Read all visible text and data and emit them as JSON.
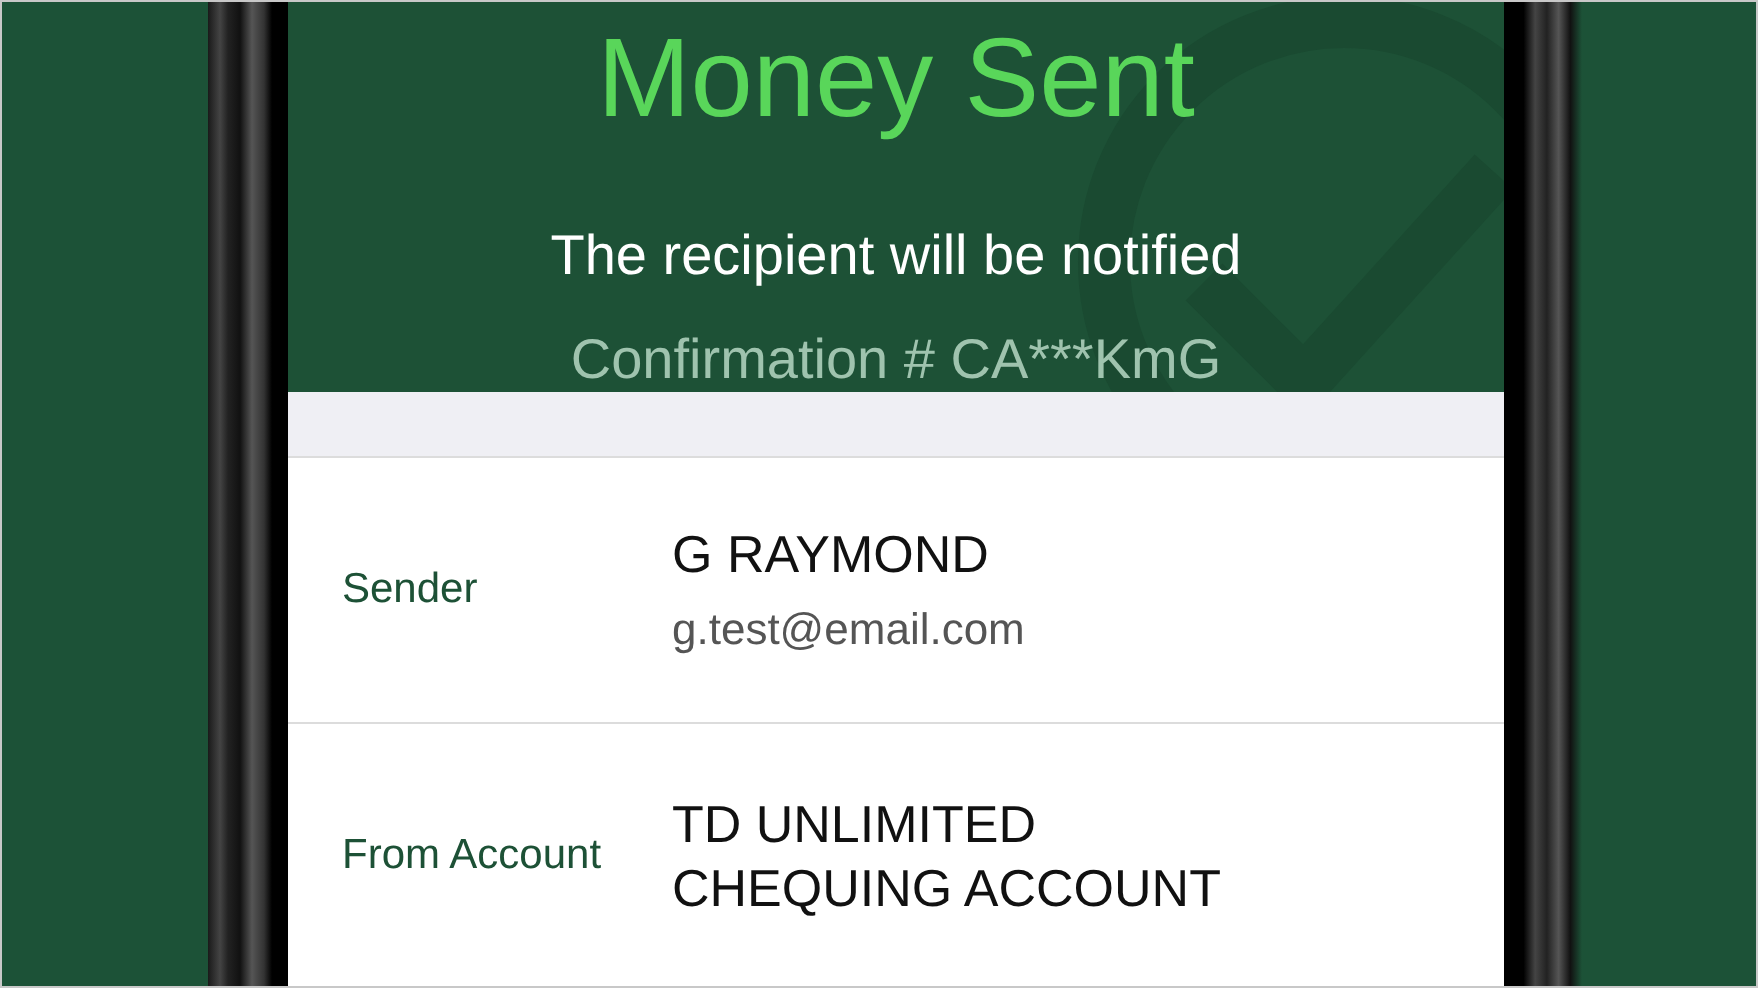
{
  "header": {
    "title": "Money Sent",
    "subtitle": "The recipient will be notified",
    "confirmation": "Confirmation # CA***KmG"
  },
  "details": [
    {
      "label": "Sender",
      "lines": [
        {
          "kind": "primary",
          "text": "G RAYMOND"
        },
        {
          "kind": "secondary",
          "text": "g.test@email.com"
        }
      ]
    },
    {
      "label": "From Account",
      "lines": [
        {
          "kind": "primary",
          "text": "TD UNLIMITED"
        },
        {
          "kind": "primary",
          "text": "CHEQUING ACCOUNT"
        }
      ]
    }
  ]
}
